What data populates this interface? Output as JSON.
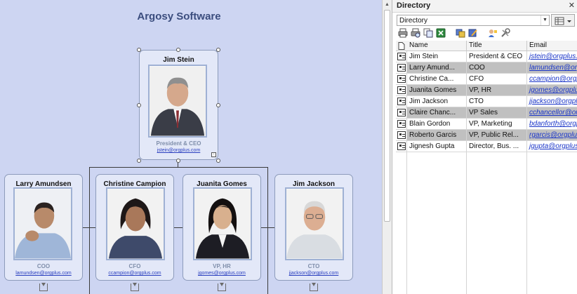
{
  "chart": {
    "title": "Argosy Software",
    "root": {
      "name": "Jim Stein",
      "role": "President & CEO",
      "email": "jstein@orgplus.com"
    },
    "children": [
      {
        "name": "Larry  Amundsen",
        "role": "COO",
        "email": "lamundsen@orgplus.com"
      },
      {
        "name": "Christine  Campion",
        "role": "CFO",
        "email": "ccampion@orgplus.com"
      },
      {
        "name": "Juanita  Gomes",
        "role": "VP, HR",
        "email": "jgomes@orgplus.com"
      },
      {
        "name": "Jim  Jackson",
        "role": "CTO",
        "email": "jjackson@orgplus.com"
      }
    ]
  },
  "directory": {
    "title": "Directory",
    "close_glyph": "✕",
    "select_value": "Directory",
    "columns": {
      "name": "Name",
      "title": "Title",
      "email": "Email"
    },
    "toolbar_icons": [
      "print-icon",
      "print-preview-icon",
      "copy-icon",
      "export-excel-icon",
      "sync-icon",
      "edit-icon",
      "add-person-icon",
      "tools-icon"
    ],
    "rows": [
      {
        "name": "Jim Stein",
        "title": "President & CEO",
        "email": "jstein@orgplus.com"
      },
      {
        "name": "Larry  Amund...",
        "title": "COO",
        "email": "lamundsen@orgplus.com"
      },
      {
        "name": "Christine  Ca...",
        "title": "CFO",
        "email": "ccampion@orgplus.com"
      },
      {
        "name": "Juanita  Gomes",
        "title": "VP, HR",
        "email": "jgomes@orgplus.com"
      },
      {
        "name": "Jim  Jackson",
        "title": "CTO",
        "email": "jjackson@orgplus.com"
      },
      {
        "name": "Claire  Chanc...",
        "title": "VP Sales",
        "email": "cchancellor@orgplus.com"
      },
      {
        "name": "Blain Gordon",
        "title": "VP, Marketing",
        "email": "bdanforth@orgplus.com"
      },
      {
        "name": "Roberto  Garcis",
        "title": "VP, Public Rel...",
        "email": "rgarcis@orgplus.com"
      },
      {
        "name": "Jignesh  Gupta",
        "title": "Director, Bus. ...",
        "email": "jgupta@orgplus.com"
      }
    ]
  },
  "colors": {
    "canvas": "#cdd5f2",
    "card": "#e3e8f8",
    "title": "#3b4d7e",
    "link": "#1a35c8",
    "row_highlight": "#c0c0c0"
  }
}
